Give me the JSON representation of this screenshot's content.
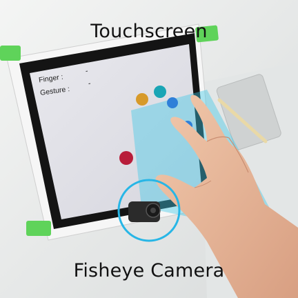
{
  "captions": {
    "top": "Touchscreen",
    "bottom": "Fisheye Camera"
  },
  "screen": {
    "finger_label": "Finger :",
    "finger_value": "-",
    "gesture_label": "Gesture :",
    "gesture_value": "-"
  },
  "colors": {
    "dot_orange": "#d79a2a",
    "dot_teal": "#1aa5b5",
    "dot_blue": "#2f7fd8",
    "dot_red": "#b81d3a",
    "fov_cyan": "#3fc7e6",
    "highlight_ring": "#27b6e6"
  }
}
